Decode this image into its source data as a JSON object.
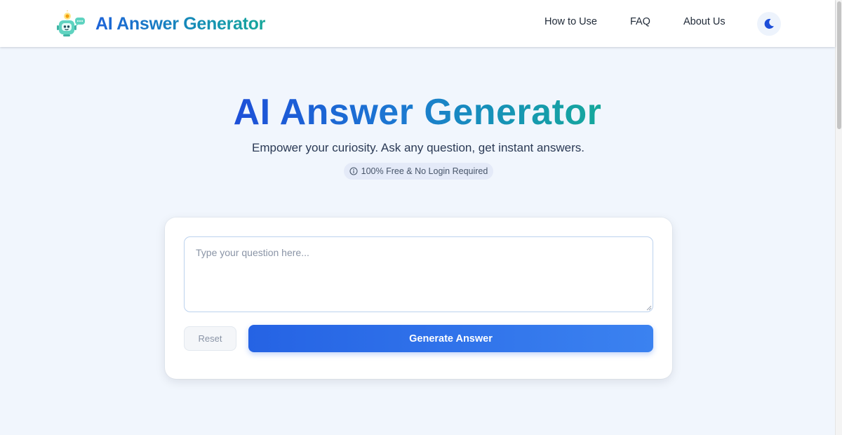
{
  "header": {
    "brand": "AI Answer Generator",
    "nav": [
      "How to Use",
      "FAQ",
      "About Us"
    ],
    "theme_icon": "moon-icon"
  },
  "hero": {
    "title": "AI Answer Generator",
    "subtitle": "Empower your curiosity. Ask any question, get instant answers.",
    "badge": "100% Free & No Login Required",
    "badge_icon": "info-icon"
  },
  "form": {
    "question_value": "",
    "question_placeholder": "Type your question here...",
    "reset_label": "Reset",
    "generate_label": "Generate Answer"
  },
  "colors": {
    "page_bg": "#f1f6fd",
    "primary": "#2563eb",
    "teal": "#16a89c",
    "moon": "#1d4ed8"
  }
}
